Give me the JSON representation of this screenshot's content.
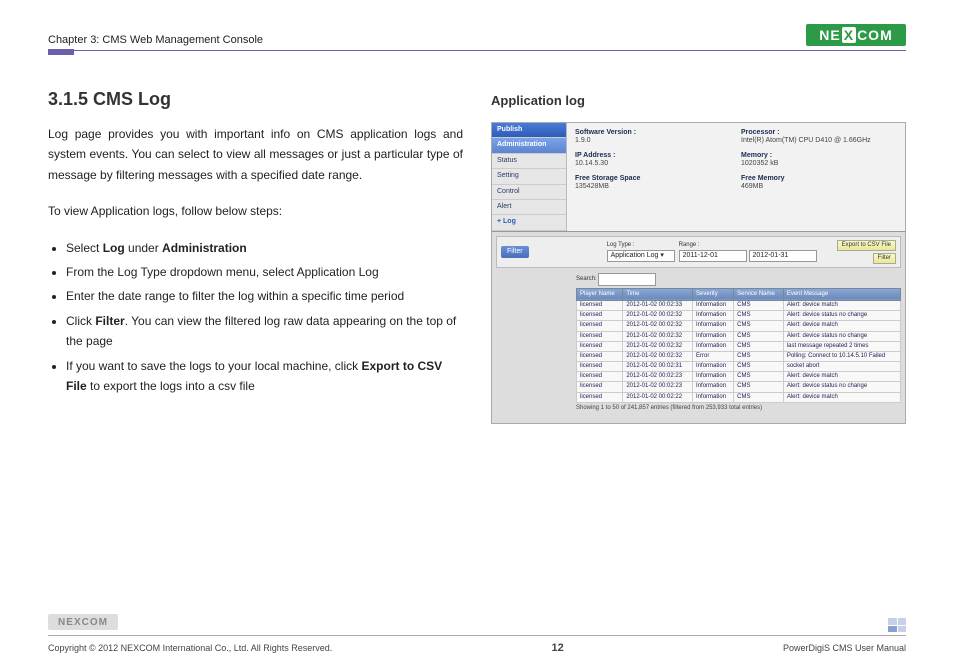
{
  "header": {
    "chapter": "Chapter 3: CMS Web Management Console",
    "brand": "NEXCOM"
  },
  "left": {
    "section_title": "3.1.5 CMS Log",
    "intro": "Log page provides you with important info on CMS application logs and system events. You can select to view all messages or just a particular type of message by filtering messages with a specified date range.",
    "steps_intro": "To view Application logs, follow below steps:",
    "step1_a": "Select ",
    "step1_b": "Log",
    "step1_c": " under ",
    "step1_d": "Administration",
    "step2": "From the Log Type dropdown menu, select Application Log",
    "step3": "Enter the date range to filter the log within a specific time period",
    "step4_a": "Click ",
    "step4_b": "Filter",
    "step4_c": ". You can view the filtered log raw data appearing on the top of the page",
    "step5_a": "If you want to save the logs to your local machine, click ",
    "step5_b": "Export to CSV File",
    "step5_c": " to export the logs into a csv file"
  },
  "right": {
    "title": "Application log",
    "sidebar": {
      "publish": "Publish",
      "administration": "Administration",
      "items": [
        "Status",
        "Setting",
        "Control",
        "Alert"
      ],
      "log": "+ Log"
    },
    "info": {
      "sw_label": "Software Version :",
      "sw_val": "1.9.0",
      "proc_label": "Processor :",
      "proc_val": "Intel(R) Atom(TM) CPU D410 @ 1.66GHz",
      "ip_label": "IP Address :",
      "ip_val": "10.14.5.30",
      "mem_label": "Memory :",
      "mem_val": "1020352 kB",
      "storage_label": "Free Storage Space",
      "storage_val": "135428MB",
      "freemem_label": "Free Memory",
      "freemem_val": "469MB"
    },
    "filter": {
      "tab": "Filter",
      "logtype_label": "Log Type :",
      "logtype_val": "Application Log",
      "range_label": "Range :",
      "range_from": "2011-12-01",
      "range_to": "2012-01-31",
      "export_btn": "Export to CSV File",
      "filter_btn": "Filter",
      "search_label": "Search:"
    },
    "table": {
      "headers": [
        "Player Name",
        "Time",
        "Severity",
        "Service Name",
        "Event Message"
      ],
      "rows": [
        [
          "licensed",
          "2012-01-02 00:02:33",
          "Information",
          "CMS",
          "Alert: device match"
        ],
        [
          "licensed",
          "2012-01-02 00:02:32",
          "Information",
          "CMS",
          "Alert: device status no change"
        ],
        [
          "licensed",
          "2012-01-02 00:02:32",
          "Information",
          "CMS",
          "Alert: device match"
        ],
        [
          "licensed",
          "2012-01-02 00:02:32",
          "Information",
          "CMS",
          "Alert: device status no change"
        ],
        [
          "licensed",
          "2012-01-02 00:02:32",
          "Information",
          "CMS",
          "last message repeated 2 times"
        ],
        [
          "licensed",
          "2012-01-02 00:02:32",
          "Error",
          "CMS",
          "Polling: Connect to 10.14.5.10 Failed"
        ],
        [
          "licensed",
          "2012-01-02 00:02:31",
          "Information",
          "CMS",
          "socket abort"
        ],
        [
          "licensed",
          "2012-01-02 00:02:23",
          "Information",
          "CMS",
          "Alert: device match"
        ],
        [
          "licensed",
          "2012-01-02 00:02:23",
          "Information",
          "CMS",
          "Alert: device status no change"
        ],
        [
          "licensed",
          "2012-01-02 00:02:22",
          "Information",
          "CMS",
          "Alert: device match"
        ]
      ],
      "footer": "Showing 1 to 50 of 241,857 entries (filtered from 253,933 total entries)"
    }
  },
  "footer": {
    "copyright": "Copyright © 2012 NEXCOM International Co., Ltd. All Rights Reserved.",
    "page": "12",
    "manual": "PowerDigiS CMS User Manual",
    "brand": "NEXCOM"
  }
}
